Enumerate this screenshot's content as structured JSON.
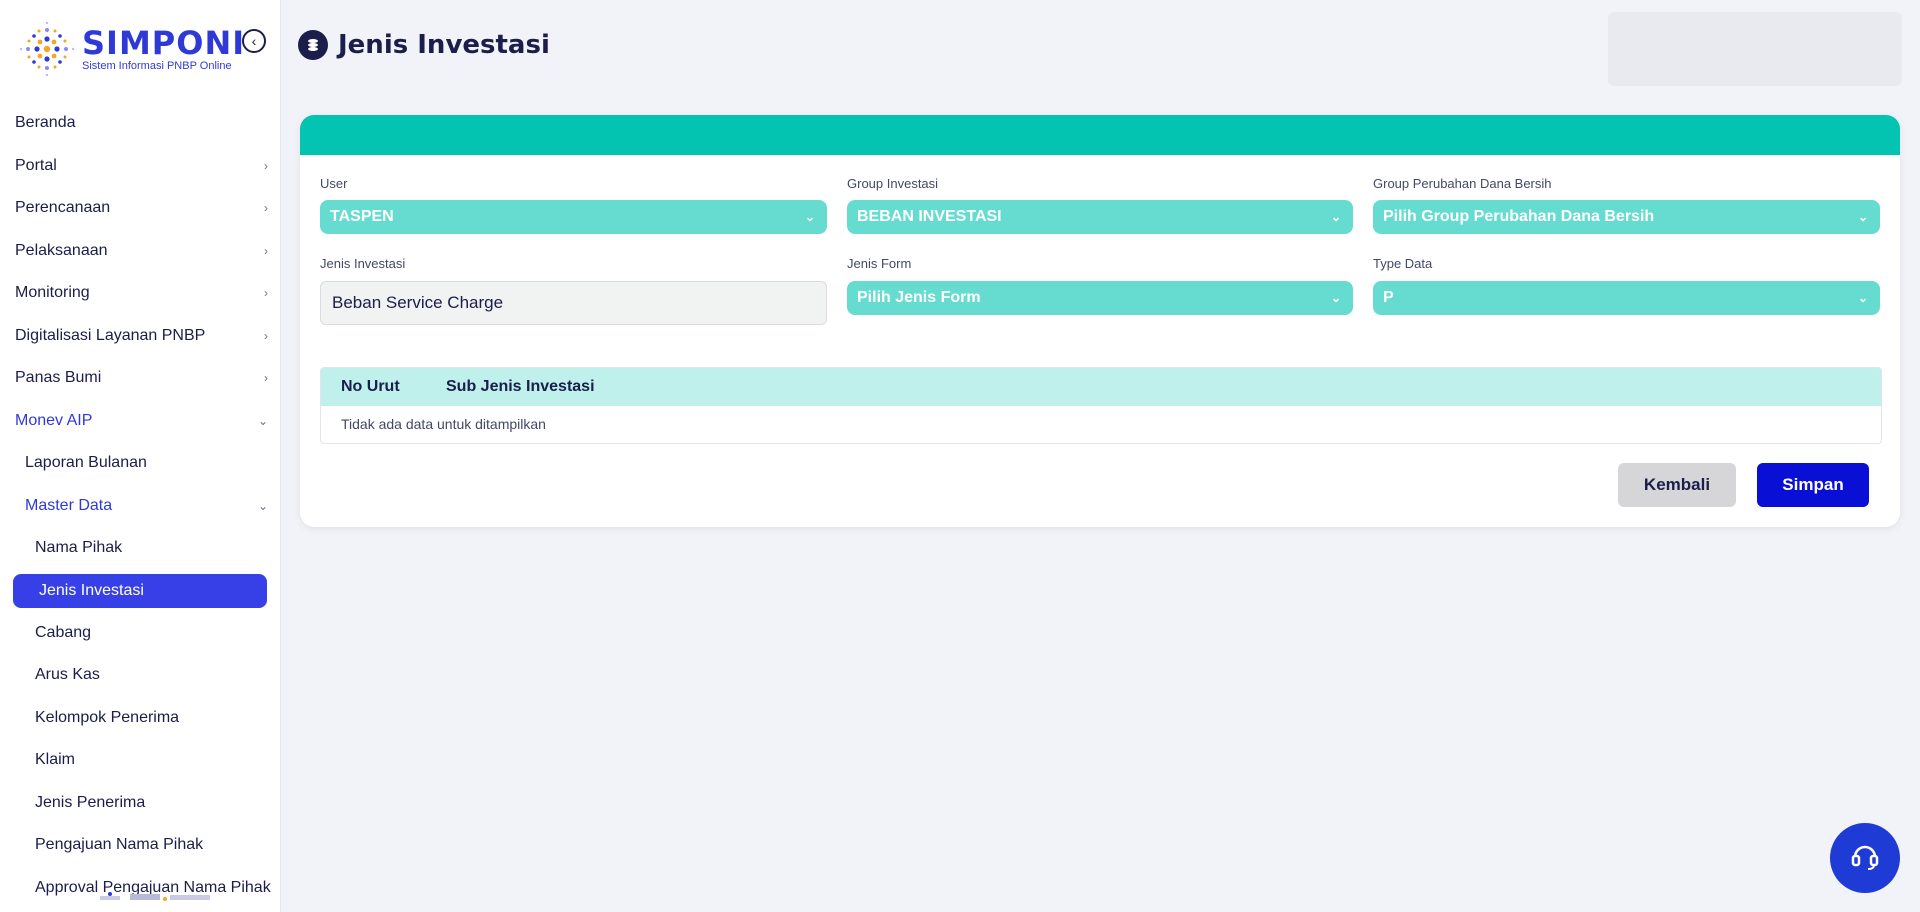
{
  "app": {
    "logo_title": "SIMPONI",
    "logo_subtitle": "Sistem Informasi PNBP Online"
  },
  "colors": {
    "brand": "#2f3ad6",
    "active_nav": "#3640e6",
    "teal_header": "#02c4b0",
    "teal_select": "#66dcd1",
    "save_button": "#0a0fd6"
  },
  "page": {
    "title": "Jenis Investasi"
  },
  "sidebar": {
    "items": [
      {
        "label": "Beranda",
        "chevron": ""
      },
      {
        "label": "Portal",
        "chevron": "›"
      },
      {
        "label": "Perencanaan",
        "chevron": "›"
      },
      {
        "label": "Pelaksanaan",
        "chevron": "›"
      },
      {
        "label": "Monitoring",
        "chevron": "›"
      },
      {
        "label": "Digitalisasi Layanan PNBP",
        "chevron": "›"
      },
      {
        "label": "Panas Bumi",
        "chevron": "›"
      },
      {
        "label": "Monev AIP",
        "chevron": "⌄"
      },
      {
        "label": "Laporan Bulanan",
        "chevron": ""
      },
      {
        "label": "Master Data",
        "chevron": "⌄"
      },
      {
        "label": "Nama Pihak",
        "chevron": ""
      },
      {
        "label": "Jenis Investasi",
        "chevron": ""
      },
      {
        "label": "Cabang",
        "chevron": ""
      },
      {
        "label": "Arus Kas",
        "chevron": ""
      },
      {
        "label": "Kelompok Penerima",
        "chevron": ""
      },
      {
        "label": "Klaim",
        "chevron": ""
      },
      {
        "label": "Jenis Penerima",
        "chevron": ""
      },
      {
        "label": "Pengajuan Nama Pihak",
        "chevron": ""
      },
      {
        "label": "Approval Pengajuan Nama Pihak",
        "chevron": ""
      }
    ]
  },
  "form": {
    "user": {
      "label": "User",
      "value": "TASPEN"
    },
    "group_investasi": {
      "label": "Group Investasi",
      "value": "BEBAN INVESTASI"
    },
    "group_perubahan": {
      "label": "Group Perubahan Dana Bersih",
      "value": "Pilih Group Perubahan Dana Bersih"
    },
    "jenis_investasi": {
      "label": "Jenis Investasi",
      "value": "Beban Service Charge"
    },
    "jenis_form": {
      "label": "Jenis Form",
      "value": "Pilih Jenis Form"
    },
    "type_data": {
      "label": "Type Data",
      "value": "P"
    }
  },
  "table": {
    "columns": [
      "No Urut",
      "Sub Jenis Investasi"
    ],
    "empty_text": "Tidak ada data untuk ditampilkan"
  },
  "buttons": {
    "back": "Kembali",
    "save": "Simpan"
  },
  "icons": {
    "collapse": "chevron-left-circle-icon",
    "page": "coins-icon",
    "select_arrow": "chevron-down-icon",
    "help": "headset-icon"
  }
}
